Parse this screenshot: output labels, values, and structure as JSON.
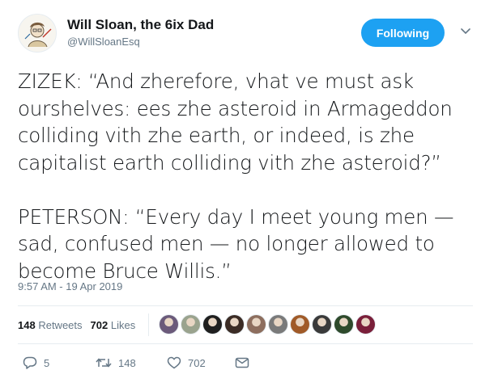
{
  "header": {
    "display_name": "Will Sloan, the 6ix Dad",
    "handle": "@WillSloanEsq",
    "avatar_icon": "sketch-portrait-avatar",
    "follow_button_label": "Following",
    "menu_icon": "chevron-down-icon"
  },
  "tweet": {
    "paragraphs": [
      "ZIZEK: “And zherefore, vhat ve must ask ourshelves: ees zhe asteroid in Armageddon colliding vith zhe earth, or indeed, is zhe capitalist earth colliding vith zhe asteroid?”",
      "PETERSON: “Every day I meet young men — sad, confused men — no longer allowed to become Bruce Willis.”"
    ],
    "timestamp": "9:57 AM - 19 Apr 2019"
  },
  "stats": {
    "retweets_count": "148",
    "retweets_label": "Retweets",
    "likes_count": "702",
    "likes_label": "Likes",
    "liker_avatars": [
      {
        "icon": "liker-avatar-1",
        "color": "#6b5a7a"
      },
      {
        "icon": "liker-avatar-2",
        "color": "#9aa38e"
      },
      {
        "icon": "liker-avatar-3",
        "color": "#1f1f1f"
      },
      {
        "icon": "liker-avatar-4",
        "color": "#3b2c25"
      },
      {
        "icon": "liker-avatar-5",
        "color": "#8d6e5e"
      },
      {
        "icon": "liker-avatar-6",
        "color": "#7a7a7a"
      },
      {
        "icon": "liker-avatar-7",
        "color": "#a05a28"
      },
      {
        "icon": "liker-avatar-8",
        "color": "#3a3a3a"
      },
      {
        "icon": "liker-avatar-9",
        "color": "#2e4a2c"
      },
      {
        "icon": "liker-avatar-10",
        "color": "#7a1f3a"
      }
    ]
  },
  "actions": {
    "reply_count": "5",
    "retweet_count": "148",
    "like_count": "702",
    "icons": [
      "reply-icon",
      "retweet-icon",
      "heart-icon",
      "direct-message-icon"
    ]
  },
  "colors": {
    "accent": "#1da1f2",
    "text": "#14171a",
    "muted": "#657786",
    "divider": "#e6ecf0"
  }
}
